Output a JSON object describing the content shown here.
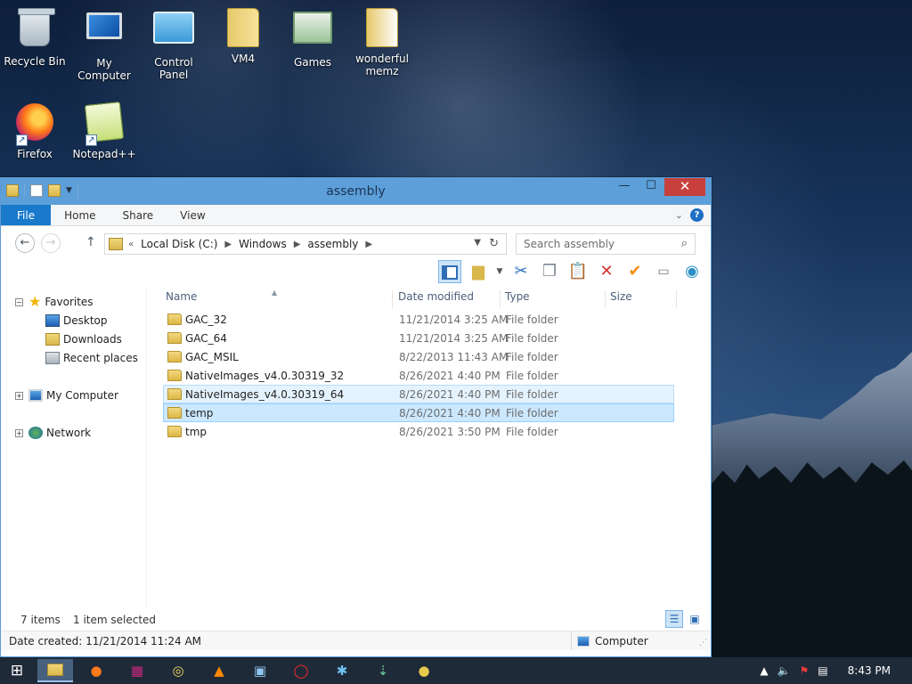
{
  "desktop": {
    "icons": [
      {
        "label": "Recycle Bin"
      },
      {
        "label": "My Computer"
      },
      {
        "label": "Control Panel"
      },
      {
        "label": "VM4"
      },
      {
        "label": "Games"
      },
      {
        "label": "wonderful memz"
      },
      {
        "label": "Firefox"
      },
      {
        "label": "Notepad++"
      }
    ]
  },
  "window": {
    "title": "assembly",
    "controls": {
      "minimize": "—",
      "maximize": "☐",
      "close": "✕"
    },
    "ribbon_tabs": [
      "File",
      "Home",
      "Share",
      "View"
    ],
    "address": {
      "overflow": "«",
      "crumbs": [
        "Local Disk (C:)",
        "Windows",
        "assembly"
      ]
    },
    "search": {
      "placeholder": "Search assembly"
    },
    "columns": {
      "name": "Name",
      "date": "Date modified",
      "type": "Type",
      "size": "Size"
    },
    "nav": {
      "favorites": "Favorites",
      "desktop": "Desktop",
      "downloads": "Downloads",
      "recent": "Recent places",
      "computer": "My Computer",
      "network": "Network"
    },
    "files": [
      {
        "name": "GAC_32",
        "date": "11/21/2014 3:25 AM",
        "type": "File folder",
        "state": "normal"
      },
      {
        "name": "GAC_64",
        "date": "11/21/2014 3:25 AM",
        "type": "File folder",
        "state": "normal"
      },
      {
        "name": "GAC_MSIL",
        "date": "8/22/2013 11:43 AM",
        "type": "File folder",
        "state": "normal"
      },
      {
        "name": "NativeImages_v4.0.30319_32",
        "date": "8/26/2021 4:40 PM",
        "type": "File folder",
        "state": "normal"
      },
      {
        "name": "NativeImages_v4.0.30319_64",
        "date": "8/26/2021 4:40 PM",
        "type": "File folder",
        "state": "hover"
      },
      {
        "name": "temp",
        "date": "8/26/2021 4:40 PM",
        "type": "File folder",
        "state": "selected"
      },
      {
        "name": "tmp",
        "date": "8/26/2021 3:50 PM",
        "type": "File folder",
        "state": "normal"
      }
    ],
    "status": {
      "items": "7 items",
      "selected": "1 item selected"
    },
    "details": {
      "date_created": "Date created: 11/21/2014 11:24 AM",
      "location": "Computer"
    }
  },
  "taskbar": {
    "clock": "8:43 PM",
    "apps": [
      "file-explorer",
      "firefox",
      "winrar",
      "disc",
      "vlc",
      "computer",
      "opera",
      "app",
      "app",
      "app"
    ]
  },
  "colors": {
    "titlebar": "#5d9fd9",
    "file_tab": "#1979ca",
    "close_button": "#c8403d",
    "selection": "#cce8ff",
    "taskbar": "#1f2a38"
  }
}
